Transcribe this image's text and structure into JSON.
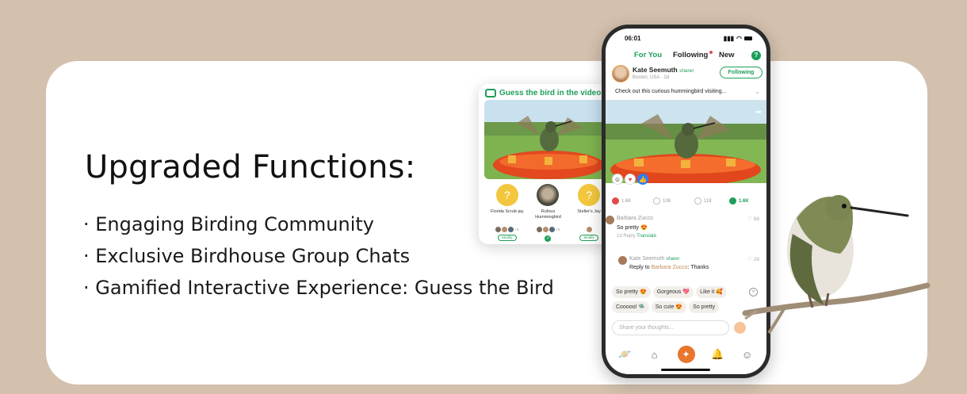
{
  "headline": "Upgraded Functions:",
  "features": [
    "· Engaging Birding Community",
    "· Exclusive Birdhouse Group Chats",
    "· Gamified Interactive Experience:  Guess the Bird"
  ],
  "guess_card": {
    "title": "Guess the bird in the video",
    "options": [
      {
        "name": "Florida Scrub-jay",
        "action": "Modify",
        "extra": "+3"
      },
      {
        "name": "Rufous Hummingbird",
        "action": "✓",
        "extra": "+3"
      },
      {
        "name": "Steller's Jay",
        "action": "Modify",
        "extra": ""
      }
    ]
  },
  "phone": {
    "time": "06:01",
    "tabs": [
      "For You",
      "Following",
      "New"
    ],
    "active_tab": "For You",
    "post": {
      "user": "Kate Seemuth",
      "role": "sharer",
      "location": "Boston, USA · 2d",
      "follow_label": "Following",
      "caption": "Check out this curious hummingbird visiting..."
    },
    "stats": [
      {
        "value": "1.6K",
        "icon": "heart"
      },
      {
        "value": "108",
        "icon": "share"
      },
      {
        "value": "118",
        "icon": "bookmark"
      },
      {
        "value": "1.6K",
        "icon": "comment"
      }
    ],
    "comments": [
      {
        "name": "Barbara Zucco",
        "text": "So pretty 😍",
        "time": "1d",
        "reply": "Reply",
        "translate": "Translate",
        "likes": "68"
      },
      {
        "name": "Kate Seemuth",
        "role": "sharer",
        "reply_prefix": "Reply to",
        "reply_to": "Barbara Zucco",
        "text": ":  Thanks",
        "likes": "28"
      }
    ],
    "chips_row1": [
      "So pretty 😍",
      "Gorgeous 💖",
      "Like it 🥰"
    ],
    "chips_row2": [
      "Coooool 🛸",
      "So cute 😍",
      "So pretty"
    ],
    "input_placeholder": "Share your thoughts..."
  },
  "colors": {
    "accent": "#1e9e5a",
    "background": "#d3c0ad",
    "orange": "#e8762d"
  }
}
